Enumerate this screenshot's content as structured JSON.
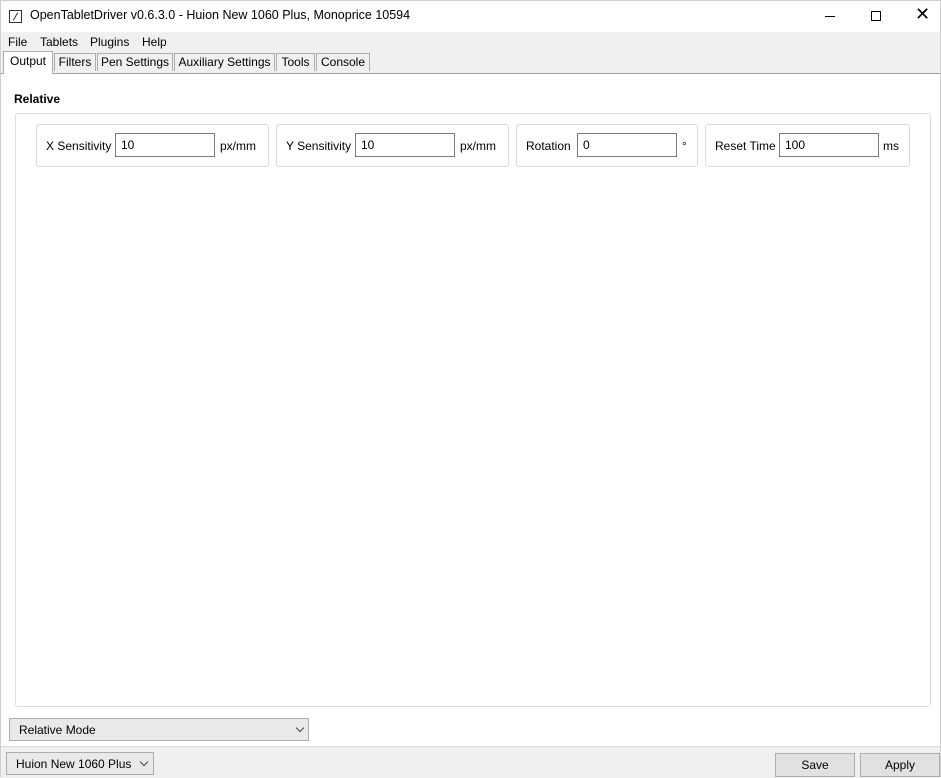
{
  "window": {
    "title": "OpenTabletDriver v0.6.3.0 - Huion New 1060 Plus, Monoprice 10594"
  },
  "menu": {
    "items": [
      "File",
      "Tablets",
      "Plugins",
      "Help"
    ]
  },
  "tabs": {
    "items": [
      "Output",
      "Filters",
      "Pen Settings",
      "Auxiliary Settings",
      "Tools",
      "Console"
    ],
    "active": "Output"
  },
  "section": {
    "title": "Relative"
  },
  "fields": {
    "x_sensitivity": {
      "label": "X Sensitivity",
      "value": "10",
      "unit": "px/mm"
    },
    "y_sensitivity": {
      "label": "Y Sensitivity",
      "value": "10",
      "unit": "px/mm"
    },
    "rotation": {
      "label": "Rotation",
      "value": "0",
      "unit": "°"
    },
    "reset_time": {
      "label": "Reset Time",
      "value": "100",
      "unit": "ms"
    }
  },
  "mode_select": {
    "value": "Relative Mode"
  },
  "tablet_select": {
    "value": "Huion New 1060 Plus"
  },
  "buttons": {
    "save": "Save",
    "apply": "Apply"
  },
  "colors": {
    "chrome": "#f0f0f0",
    "border": "#dcdcdc",
    "button": "#e1e1e1"
  }
}
